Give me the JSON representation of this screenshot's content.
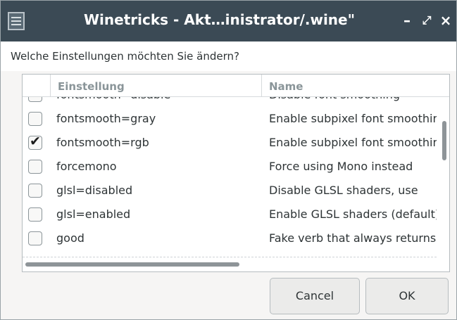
{
  "window": {
    "title": "Winetricks - Akt…inistrator/.wine\"",
    "minimize_glyph": "–",
    "maximize_glyph": "⤢",
    "close_glyph": "×",
    "titlebar_color": "#3b4a55"
  },
  "prompt": "Welche Einstellungen möchten Sie ändern?",
  "columns": {
    "check": "",
    "setting": "Einstellung",
    "name": "Name"
  },
  "rows": [
    {
      "setting": "fontsmooth=disable",
      "name": "Disable font smoothing",
      "checked": false
    },
    {
      "setting": "fontsmooth=gray",
      "name": "Enable subpixel font smoothing",
      "checked": false
    },
    {
      "setting": "fontsmooth=rgb",
      "name": "Enable subpixel font smoothing",
      "checked": true
    },
    {
      "setting": "forcemono",
      "name": "Force using Mono instead",
      "checked": false
    },
    {
      "setting": "glsl=disabled",
      "name": "Disable GLSL shaders, use",
      "checked": false
    },
    {
      "setting": "glsl=enabled",
      "name": "Enable GLSL shaders (default)",
      "checked": false
    },
    {
      "setting": "good",
      "name": "Fake verb that always returns",
      "checked": false
    }
  ],
  "buttons": {
    "cancel": "Cancel",
    "ok": "OK"
  },
  "icons": {
    "check": "✔",
    "window_menu": "menu-icon"
  }
}
